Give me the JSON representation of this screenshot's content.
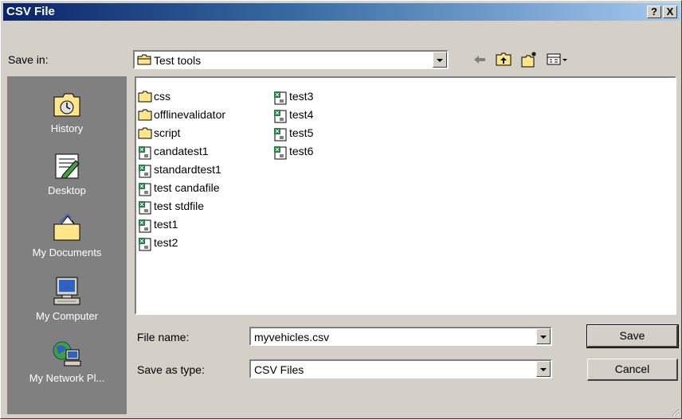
{
  "window": {
    "title": "CSV File",
    "help_label": "?",
    "close_label": "X"
  },
  "save_in": {
    "label": "Save in:",
    "value": "Test tools"
  },
  "places": [
    {
      "label": "History",
      "icon": "history-icon"
    },
    {
      "label": "Desktop",
      "icon": "desktop-icon"
    },
    {
      "label": "My Documents",
      "icon": "my-documents-icon"
    },
    {
      "label": "My Computer",
      "icon": "my-computer-icon"
    },
    {
      "label": "My Network Pl...",
      "icon": "network-places-icon"
    }
  ],
  "files": [
    {
      "name": "css",
      "type": "folder"
    },
    {
      "name": "offlinevalidator",
      "type": "folder"
    },
    {
      "name": "script",
      "type": "folder"
    },
    {
      "name": "candatest1",
      "type": "excel"
    },
    {
      "name": "standardtest1",
      "type": "excel"
    },
    {
      "name": "test candafile",
      "type": "excel"
    },
    {
      "name": "test stdfile",
      "type": "excel"
    },
    {
      "name": "test1",
      "type": "excel"
    },
    {
      "name": "test2",
      "type": "excel"
    },
    {
      "name": "test3",
      "type": "excel"
    },
    {
      "name": "test4",
      "type": "excel"
    },
    {
      "name": "test5",
      "type": "excel"
    },
    {
      "name": "test6",
      "type": "excel"
    }
  ],
  "file_name": {
    "label": "File name:",
    "value": "myvehicles.csv"
  },
  "save_as_type": {
    "label": "Save as type:",
    "value": "CSV Files"
  },
  "buttons": {
    "save": "Save",
    "cancel": "Cancel"
  },
  "colors": {
    "title_start": "#0a246a",
    "title_end": "#a6caf0",
    "face": "#d4d0c8",
    "places_bg": "#808080"
  }
}
